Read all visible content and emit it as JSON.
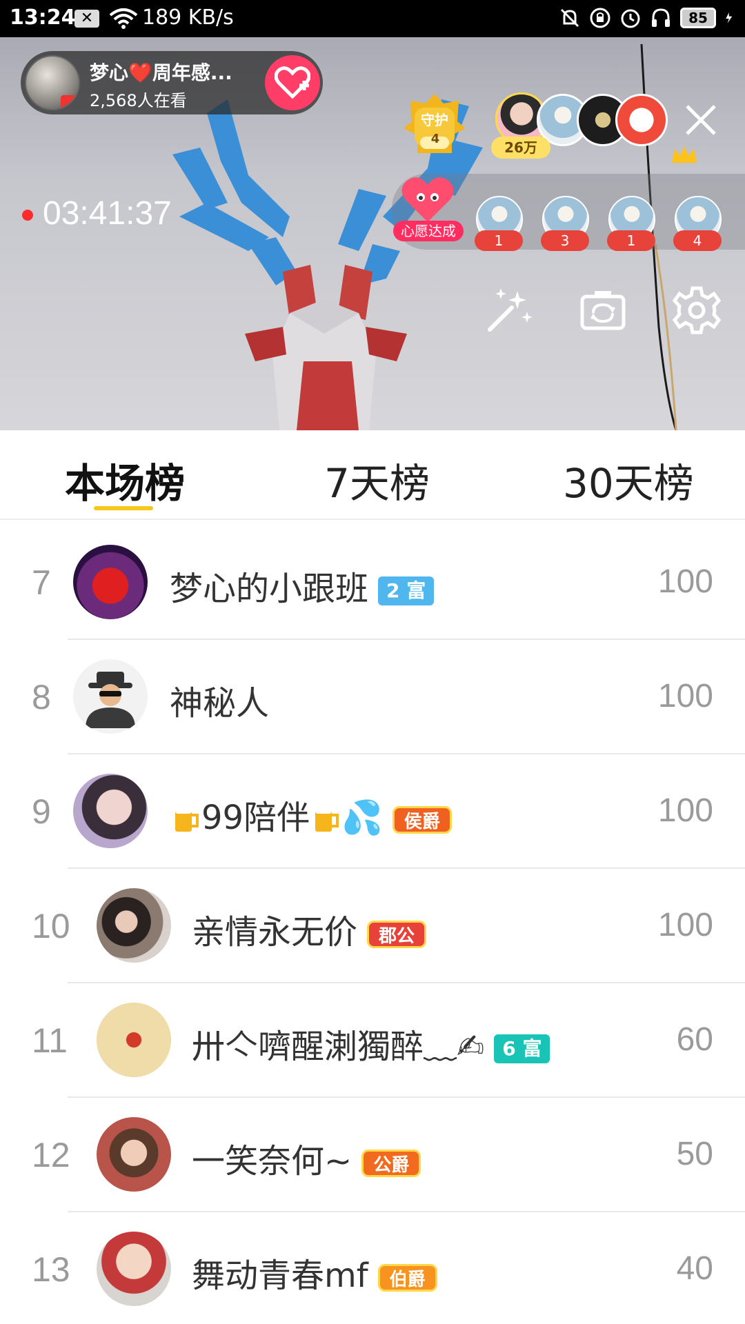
{
  "status_bar": {
    "time": "13:24",
    "speed": "189 KB/s",
    "battery": "85"
  },
  "live": {
    "host_name": "梦心❤️周年感...",
    "viewers": "2,568人在看",
    "guard_label": "守护",
    "guard_count": "4",
    "top_fans_count": "26万",
    "elapsed": "03:41:37",
    "wish_label": "心愿达成",
    "mini_fans": [
      "1",
      "3",
      "1",
      "4"
    ]
  },
  "tabs": [
    {
      "label": "本场榜",
      "active": true
    },
    {
      "label": "7天榜",
      "active": false
    },
    {
      "label": "30天榜",
      "active": false
    }
  ],
  "leaderboard": [
    {
      "rank": "7",
      "name": "梦心的小跟班",
      "badge_type": "rich",
      "badge": "2 富",
      "badge_color": "#4fb6ee",
      "score": "100"
    },
    {
      "rank": "8",
      "name": "神秘人",
      "badge_type": "",
      "badge": "",
      "badge_color": "",
      "score": "100"
    },
    {
      "rank": "9",
      "name": "99陪伴",
      "name_suffix": "💦",
      "badge_type": "title",
      "badge": "侯爵",
      "badge_color": "#f0601f",
      "score": "100"
    },
    {
      "rank": "10",
      "name": "亲情永无价",
      "badge_type": "title",
      "badge": "郡公",
      "badge_color": "#e8413a",
      "score": "100"
    },
    {
      "rank": "11",
      "name": "卅亽嚌醒溂獨醉﹏✍",
      "badge_type": "rich",
      "badge": "6 富",
      "badge_color": "#19c3b6",
      "score": "60"
    },
    {
      "rank": "12",
      "name": "一笑奈何~",
      "badge_type": "title",
      "badge": "公爵",
      "badge_color": "#f26a1e",
      "score": "50"
    },
    {
      "rank": "13",
      "name": "舞动青春mf",
      "badge_type": "title",
      "badge": "伯爵",
      "badge_color": "#f7931e",
      "score": "40"
    }
  ]
}
